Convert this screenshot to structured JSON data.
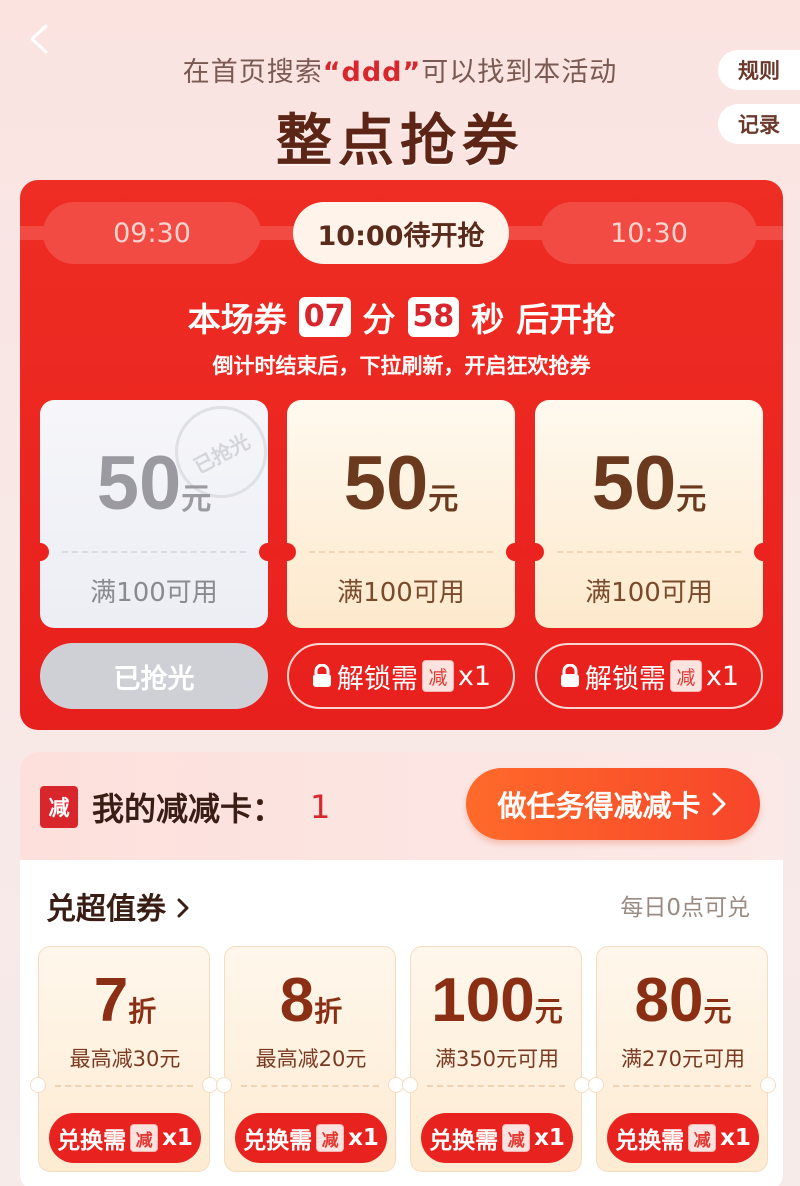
{
  "header": {
    "hint_prefix": "在首页搜索",
    "hint_keyword": "“ddd”",
    "hint_suffix": "可以找到本活动",
    "title": "整点抢券",
    "rules_label": "规则",
    "records_label": "记录"
  },
  "timeslots": [
    {
      "label": "09:30",
      "state": "inactive"
    },
    {
      "label": "10:00待开抢",
      "state": "active"
    },
    {
      "label": "10:30",
      "state": "inactive"
    }
  ],
  "countdown": {
    "prefix": "本场券",
    "minutes": "07",
    "min_unit": "分",
    "seconds": "58",
    "sec_unit": "秒",
    "suffix": "后开抢",
    "subtitle": "倒计时结束后，下拉刷新，开启狂欢抢券"
  },
  "coupons": [
    {
      "amount": "50",
      "unit": "元",
      "condition": "满100可用",
      "stamp": "已抢光",
      "button": "已抢光",
      "state": "sold_out"
    },
    {
      "amount": "50",
      "unit": "元",
      "condition": "满100可用",
      "button_prefix": "解锁需",
      "badge": "减",
      "button_suffix": "x1",
      "state": "locked"
    },
    {
      "amount": "50",
      "unit": "元",
      "condition": "满100可用",
      "button_prefix": "解锁需",
      "badge": "减",
      "button_suffix": "x1",
      "state": "locked"
    }
  ],
  "my_cards": {
    "badge": "减",
    "label": "我的减减卡：",
    "count": "1",
    "task_button": "做任务得减减卡"
  },
  "exchange": {
    "title": "兑超值券",
    "note": "每日0点可兑",
    "items": [
      {
        "value": "7",
        "unit": "折",
        "desc": "最高减30元",
        "btn_prefix": "兑换需",
        "badge": "减",
        "btn_suffix": "x1"
      },
      {
        "value": "8",
        "unit": "折",
        "desc": "最高减20元",
        "btn_prefix": "兑换需",
        "badge": "减",
        "btn_suffix": "x1"
      },
      {
        "value": "100",
        "unit": "元",
        "desc": "满350元可用",
        "btn_prefix": "兑换需",
        "badge": "减",
        "btn_suffix": "x1"
      },
      {
        "value": "80",
        "unit": "元",
        "desc": "满270元可用",
        "btn_prefix": "兑换需",
        "badge": "减",
        "btn_suffix": "x1"
      }
    ]
  },
  "colors": {
    "primary_red": "#e8201d",
    "text_brown": "#5c2516",
    "accent_orange": "#ff6a2a"
  }
}
